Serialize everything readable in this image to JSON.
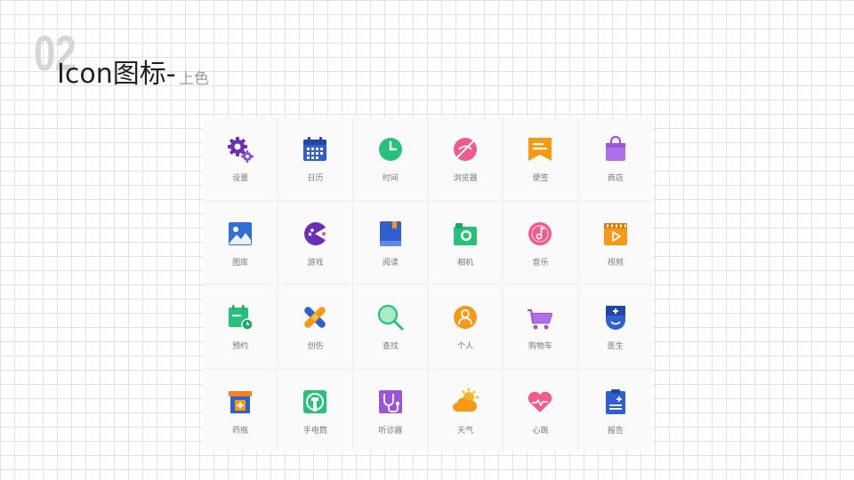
{
  "header": {
    "number": "02",
    "title": "Icon图标-",
    "subtitle": "上色"
  },
  "icons": [
    {
      "name": "settings",
      "label": "设置"
    },
    {
      "name": "calendar",
      "label": "日历"
    },
    {
      "name": "clock",
      "label": "时间"
    },
    {
      "name": "browser",
      "label": "浏览器"
    },
    {
      "name": "note",
      "label": "便签"
    },
    {
      "name": "store",
      "label": "商店"
    },
    {
      "name": "gallery",
      "label": "图库"
    },
    {
      "name": "game",
      "label": "游戏"
    },
    {
      "name": "reader",
      "label": "阅读"
    },
    {
      "name": "camera",
      "label": "相机"
    },
    {
      "name": "music",
      "label": "音乐"
    },
    {
      "name": "video",
      "label": "视频"
    },
    {
      "name": "appointment",
      "label": "预约"
    },
    {
      "name": "bandage",
      "label": "创伤"
    },
    {
      "name": "search",
      "label": "查找"
    },
    {
      "name": "person",
      "label": "个人"
    },
    {
      "name": "cart",
      "label": "购物车"
    },
    {
      "name": "doctor",
      "label": "医生"
    },
    {
      "name": "medicine-box",
      "label": "药瓶"
    },
    {
      "name": "flashlight",
      "label": "手电筒"
    },
    {
      "name": "stethoscope",
      "label": "听诊器"
    },
    {
      "name": "weather",
      "label": "天气"
    },
    {
      "name": "heartbeat",
      "label": "心跳"
    },
    {
      "name": "report",
      "label": "报告"
    }
  ]
}
